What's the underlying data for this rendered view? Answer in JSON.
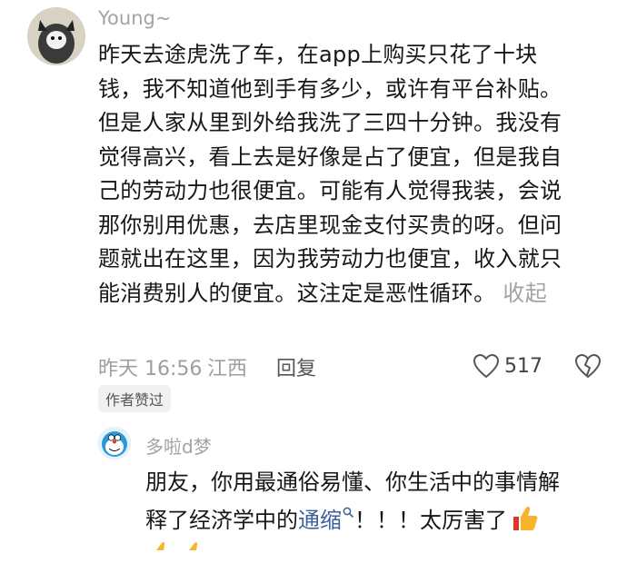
{
  "comment": {
    "username": "Young~",
    "lines": [
      "昨天去途虎洗了车，在app上购买只花了十块",
      "钱，我不知道他到手有多少，或许有平台补贴。",
      "但是人家从里到外给我洗了三四十分钟。我没有",
      "觉得高兴，看上去是好像是占了便宜，但是我自",
      "己的劳动力也很便宜。可能有人觉得我装，会说",
      "那你别用优惠，去店里现金支付买贵的呀。但问",
      "题就出在这里，因为我劳动力也便宜，收入就只",
      "能消费别人的便宜。这注定是恶性循环。"
    ],
    "collapse_label": "收起",
    "time": "昨天 16:56",
    "location": "江西",
    "reply_label": "回复",
    "like_count": "517",
    "author_liked_badge": "作者赞过"
  },
  "reply": {
    "username": "多啦d梦",
    "line1": "朋友，你用最通俗易懂、你生活中的事情解",
    "line2_before": "释了经济学中的",
    "link_text": "通缩",
    "line2_after": "！！！太厉害了"
  },
  "icons": {
    "like": "heart-outline-icon",
    "dislike": "broken-heart-icon",
    "search_link": "search-icon",
    "thumbs_up": "thumbs-up-emoji"
  }
}
